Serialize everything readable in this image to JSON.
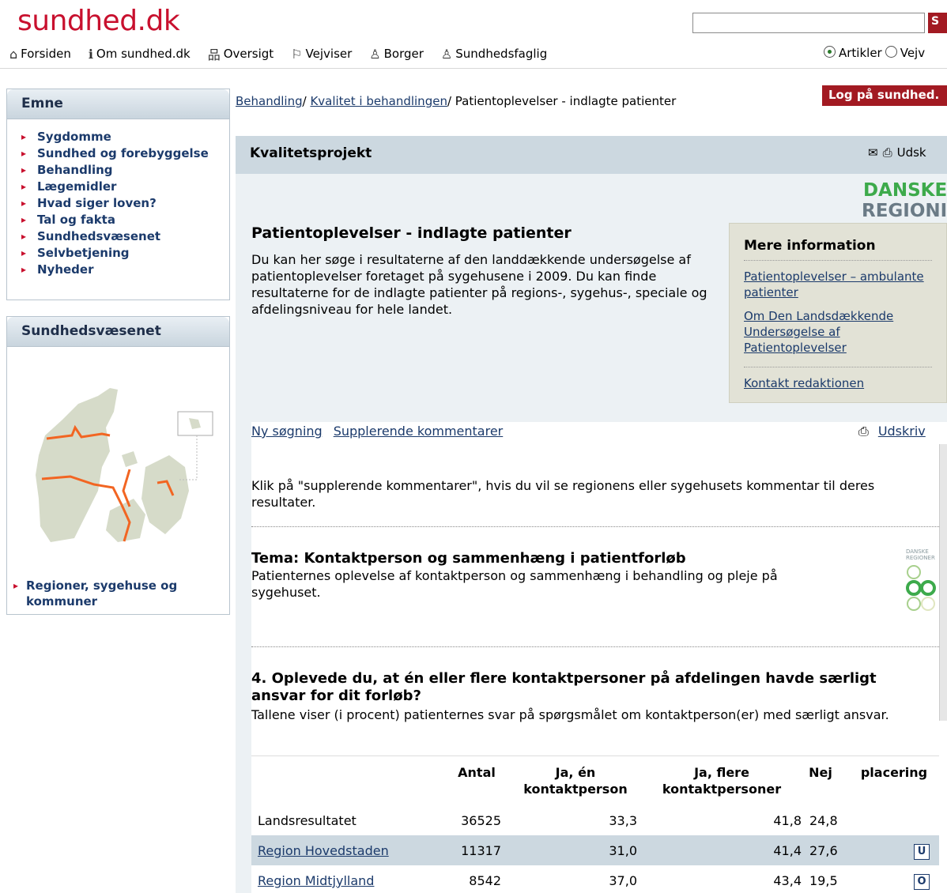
{
  "header": {
    "logo": "sundhed.dk",
    "search_button": "S",
    "nav": [
      {
        "label": "Forsiden",
        "icon": "home-icon",
        "glyph": "⌂"
      },
      {
        "label": "Om sundhed.dk",
        "icon": "info-icon",
        "glyph": "ℹ"
      },
      {
        "label": "Oversigt",
        "icon": "sitemap-icon",
        "glyph": "品"
      },
      {
        "label": "Vejviser",
        "icon": "signpost-icon",
        "glyph": "⚐"
      },
      {
        "label": "Borger",
        "icon": "person-icon",
        "glyph": "♙"
      },
      {
        "label": "Sundhedsfaglig",
        "icon": "doctor-icon",
        "glyph": "♙"
      }
    ],
    "search_type": {
      "option1": "Artikler",
      "option2": "Vejv"
    }
  },
  "sidebar": {
    "emne_title": "Emne",
    "emne_items": [
      "Sygdomme",
      "Sundhed og forebyggelse",
      "Behandling",
      "Lægemidler",
      "Hvad siger loven?",
      "Tal og fakta",
      "Sundhedsvæsenet",
      "Selvbetjening",
      "Nyheder"
    ],
    "sund_title": "Sundhedsvæsenet",
    "region_link": "Regioner, sygehuse og kommuner"
  },
  "breadcrumb": {
    "crumb1": "Behandling",
    "crumb2": "Kvalitet i behandlingen",
    "current": "Patientoplevelser - indlagte patienter"
  },
  "login_button": "Log på sundhed.",
  "section": {
    "title": "Kvalitetsprojekt",
    "tools_label": "Udsk"
  },
  "brand_logo": {
    "line1": "DANSKE",
    "line2": "REGIONI"
  },
  "page": {
    "title": "Patientoplevelser - indlagte patienter",
    "intro": "Du kan her søge i resultaterne af den landdækkende undersøgelse af patientoplevelser foretaget på sygehusene i 2009. Du kan finde resultaterne for de indlagte patienter på regions-, sygehus-, speciale og afdelingsniveau for hele landet."
  },
  "info_box": {
    "title": "Mere information",
    "link1": "Patientoplevelser – ambulante patienter",
    "link2": "Om Den Landsdækkende Undersøgelse af Patientoplevelser",
    "link3": "Kontakt redaktionen"
  },
  "content": {
    "new_search": "Ny søgning",
    "comments": "Supplerende kommentarer",
    "print": "Udskriv",
    "help_text": "Klik på \"supplerende kommentarer\", hvis du vil se regionens eller sygehusets kommentar til deres resultater.",
    "tema_title": "Tema: Kontaktperson og sammenhæng i patientforløb",
    "tema_desc": "Patienternes oplevelse af kontaktperson og sammenhæng i behandling og pleje på sygehuset.",
    "tema_logo_text": "DANSKE REGIONER",
    "question_title": "4. Oplevede du, at én eller flere kontaktpersoner på afdelingen havde særligt ansvar for dit forløb?",
    "question_desc": "Tallene viser (i procent) patienternes svar på spørgsmålet om kontaktperson(er) med særligt ansvar."
  },
  "table": {
    "headers": {
      "antal": "Antal",
      "ja_en": "Ja, én kontaktperson",
      "ja_flere": "Ja, flere kontaktpersoner",
      "nej": "Nej",
      "placering": "placering"
    },
    "rows": [
      {
        "name": "Landsresultatet",
        "antal": "36525",
        "ja_en": "33,3",
        "ja_flere": "41,8",
        "nej": "24,8",
        "badge": ""
      },
      {
        "name": "Region Hovedstaden",
        "antal": "11317",
        "ja_en": "31,0",
        "ja_flere": "41,4",
        "nej": "27,6",
        "badge": "U"
      },
      {
        "name": "Region Midtjylland",
        "antal": "8542",
        "ja_en": "37,0",
        "ja_flere": "43,4",
        "nej": "19,5",
        "badge": "O"
      }
    ]
  },
  "colors": {
    "brand_red": "#c8102e",
    "header_blue": "#ccd8e0",
    "link": "#1b3a6b",
    "region_lines": "#f26522"
  }
}
